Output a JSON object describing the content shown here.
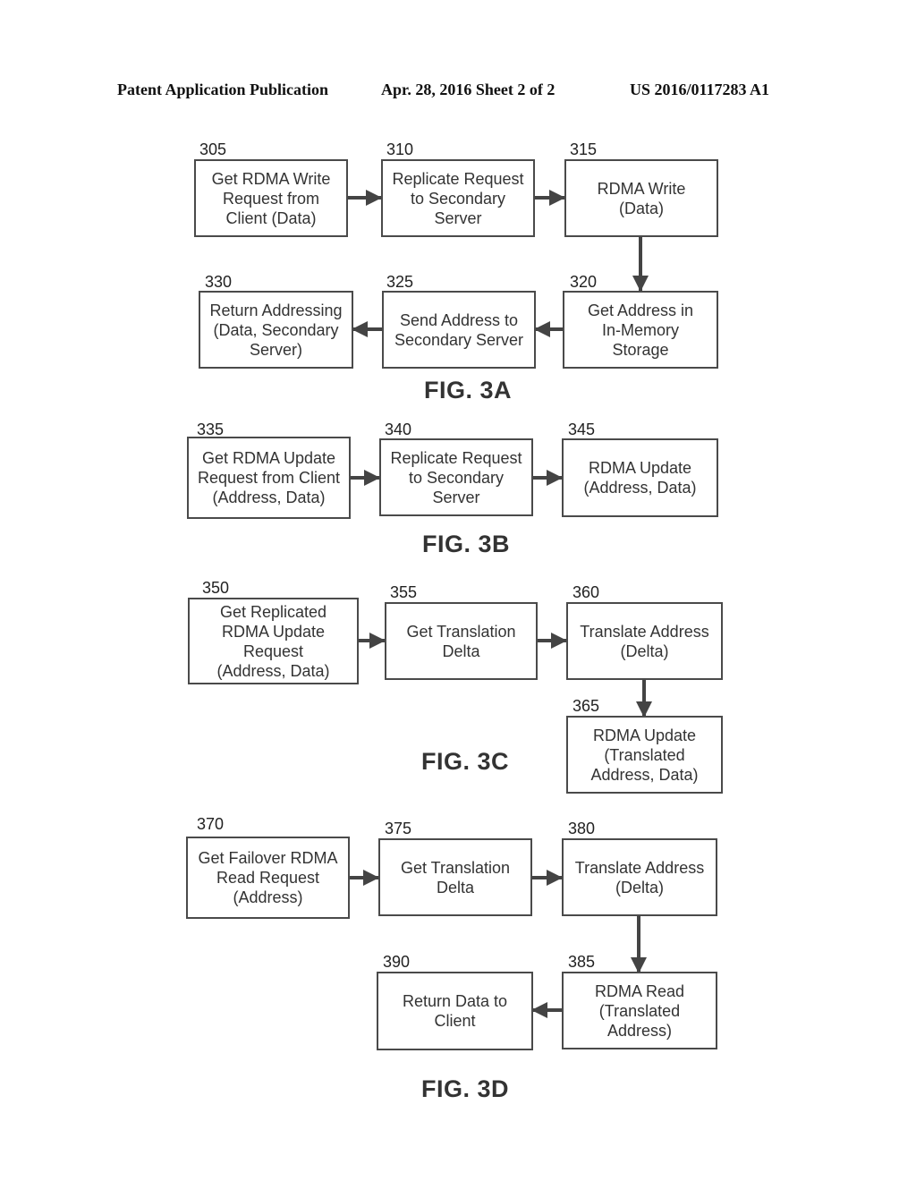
{
  "header": {
    "publication": "Patent Application Publication",
    "date_sheet": "Apr. 28, 2016  Sheet 2 of 2",
    "number": "US 2016/0117283 A1"
  },
  "figures": {
    "fig3a": {
      "label": "FIG. 3A",
      "steps": [
        {
          "ref": "305",
          "text": "Get RDMA Write\nRequest from\nClient (Data)"
        },
        {
          "ref": "310",
          "text": "Replicate Request\nto Secondary\nServer"
        },
        {
          "ref": "315",
          "text": "RDMA Write\n(Data)"
        },
        {
          "ref": "320",
          "text": "Get Address in\nIn-Memory\nStorage"
        },
        {
          "ref": "325",
          "text": "Send Address to\nSecondary Server"
        },
        {
          "ref": "330",
          "text": "Return Addressing\n(Data, Secondary\nServer)"
        }
      ]
    },
    "fig3b": {
      "label": "FIG. 3B",
      "steps": [
        {
          "ref": "335",
          "text": "Get RDMA Update\nRequest from Client\n(Address, Data)"
        },
        {
          "ref": "340",
          "text": "Replicate Request\nto Secondary\nServer"
        },
        {
          "ref": "345",
          "text": "RDMA Update\n(Address, Data)"
        }
      ]
    },
    "fig3c": {
      "label": "FIG. 3C",
      "steps": [
        {
          "ref": "350",
          "text": "Get Replicated\nRDMA Update\nRequest\n(Address, Data)"
        },
        {
          "ref": "355",
          "text": "Get Translation\nDelta"
        },
        {
          "ref": "360",
          "text": "Translate Address\n(Delta)"
        },
        {
          "ref": "365",
          "text": "RDMA Update\n(Translated\nAddress, Data)"
        }
      ]
    },
    "fig3d": {
      "label": "FIG. 3D",
      "steps": [
        {
          "ref": "370",
          "text": "Get Failover RDMA\nRead Request\n(Address)"
        },
        {
          "ref": "375",
          "text": "Get Translation\nDelta"
        },
        {
          "ref": "380",
          "text": "Translate Address\n(Delta)"
        },
        {
          "ref": "385",
          "text": "RDMA Read\n(Translated\nAddress)"
        },
        {
          "ref": "390",
          "text": "Return Data to\nClient"
        }
      ]
    }
  }
}
